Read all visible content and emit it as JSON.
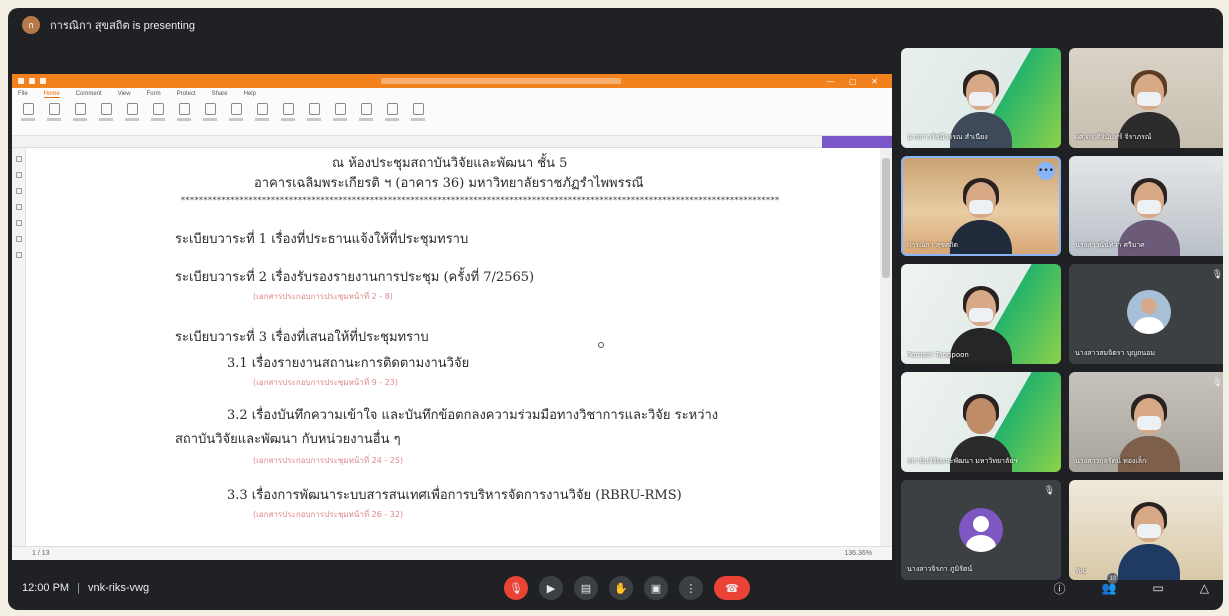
{
  "topbar": {
    "presenting": "การณิกา สุขสถิต is presenting"
  },
  "pdf": {
    "menu": [
      "File",
      "Home",
      "Comment",
      "View",
      "Form",
      "Protect",
      "Share",
      "Help"
    ],
    "zoom": "136.36%",
    "page_indicator": "1 / 13",
    "lines": {
      "heading1": "ณ  ห้องประชุมสถาบันวิจัยและพัฒนา  ชั้น  5",
      "heading2": "อาคารเฉลิมพระเกียรติ ฯ  (อาคาร 36)  มหาวิทยาลัยราชภัฏรำไพพรรณี",
      "stars": "*************************************************************************************************************************************",
      "agenda1": "ระเบียบวาระที่  1  เรื่องที่ประธานแจ้งให้ที่ประชุมทราบ",
      "agenda2": "ระเบียบวาระที่  2  เรื่องรับรองรายงานการประชุม (ครั้งที่ 7/2565)",
      "ref2": "(เอกสารประกอบการประชุมหน้าที่ 2 - 8)",
      "agenda3": "ระเบียบวาระที่  3  เรื่องที่เสนอให้ที่ประชุมทราบ",
      "item31": "3.1  เรื่องรายงานสถานะการติดตามงานวิจัย",
      "ref31": "(เอกสารประกอบการประชุมหน้าที่ 9 - 23)",
      "item32a": "3.2  เรื่องบันทึกความเข้าใจ  และบันทึกข้อตกลงความร่วมมือทางวิชาการและวิจัย  ระหว่าง",
      "item32b": "สถาบันวิจัยและพัฒนา  กับหน่วยงานอื่น ๆ",
      "ref32": "(เอกสารประกอบการประชุมหน้าที่ 24 - 25)",
      "item33": "3.3  เรื่องการพัฒนาระบบสารสนเทศเพื่อการบริหารจัดการงานวิจัย (RBRU-RMS)",
      "ref33": "(เอกสารประกอบการประชุมหน้าที่ 26 - 32)"
    }
  },
  "participants": [
    {
      "name": "นางสาวรัชนีวรรณ สำเนียง"
    },
    {
      "name": "ผศ.ดร.ศิรินันทร์ จิราภรณ์"
    },
    {
      "name": "การณิกา สุขสถิต"
    },
    {
      "name": "นางสาวนันทิวา ศรีมาศ"
    },
    {
      "name": "Pornsiri Tangpoon"
    },
    {
      "name": "นางสาวสมจิตรา บุญถนอม"
    },
    {
      "name": "สถาบันวิจัยและพัฒนา มหาวิทยาลัยฯ"
    },
    {
      "name": "นางสาวกุลรัตน์ ทองเล็ก"
    },
    {
      "name": "นางสาวจิรภา ภูมิรัตน์"
    },
    {
      "name": "You"
    }
  ],
  "bottom": {
    "time": "12:00 PM",
    "meeting_code": "vnk-riks-vwg",
    "people_count": "10"
  }
}
